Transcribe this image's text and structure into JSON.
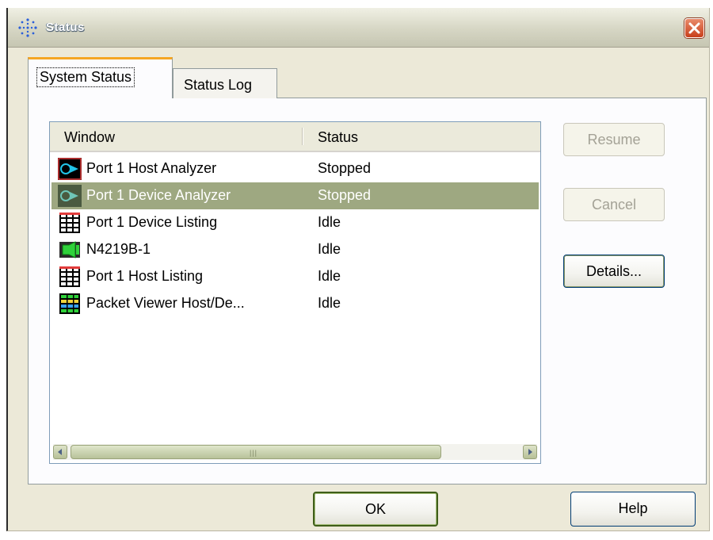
{
  "window": {
    "title": "Status",
    "icon": "sparkle-app-icon",
    "close_icon": "close-icon"
  },
  "tabs": [
    {
      "label": "System Status",
      "active": true
    },
    {
      "label": "Status Log",
      "active": false
    }
  ],
  "list": {
    "columns": [
      "Window",
      "Status"
    ],
    "rows": [
      {
        "name": "Port 1 Host Analyzer",
        "status": "Stopped",
        "icon": "analyzer-icon",
        "selected": false
      },
      {
        "name": "Port 1 Device Analyzer",
        "status": "Stopped",
        "icon": "analyzer-icon",
        "selected": true
      },
      {
        "name": "Port 1 Device Listing",
        "status": "Idle",
        "icon": "listing-icon",
        "selected": false
      },
      {
        "name": "N4219B-1",
        "status": "Idle",
        "icon": "device-icon",
        "selected": false
      },
      {
        "name": "Port 1 Host Listing",
        "status": "Idle",
        "icon": "listing-icon",
        "selected": false
      },
      {
        "name": "Packet Viewer Host/De...",
        "status": "Idle",
        "icon": "packet-viewer-icon",
        "selected": false
      }
    ]
  },
  "buttons": {
    "resume": "Resume",
    "cancel": "Cancel",
    "details": "Details...",
    "ok": "OK",
    "help": "Help"
  },
  "colors": {
    "selection": "#9ea881",
    "dialog_face": "#ece9d8",
    "tab_highlight": "#f5a623"
  }
}
